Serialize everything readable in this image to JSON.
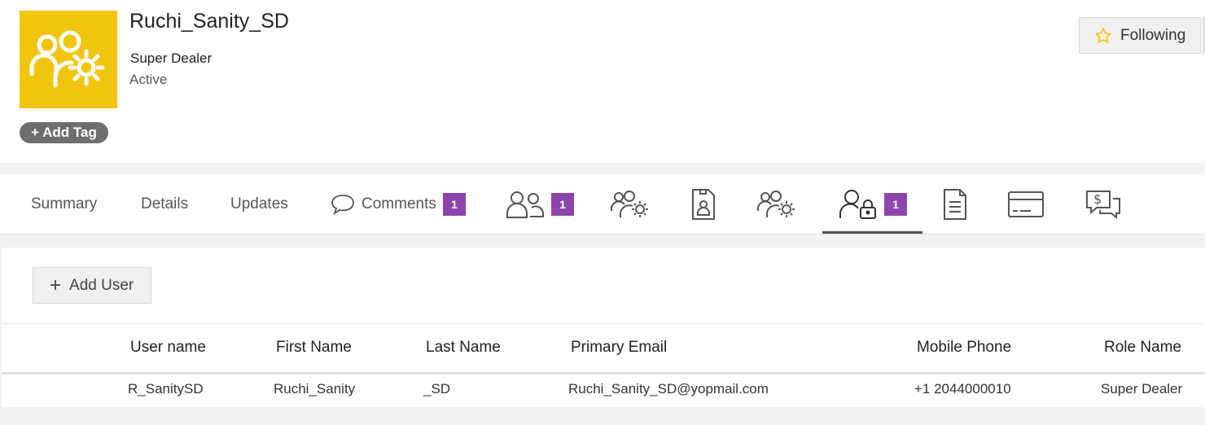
{
  "entity": {
    "name": "Ruchi_Sanity_SD",
    "type": "Super Dealer",
    "status": "Active",
    "logo_color": "#f1c40f",
    "add_tag_label": "Add Tag",
    "follow_label": "Following"
  },
  "tabs": [
    {
      "label": "Summary"
    },
    {
      "label": "Details"
    },
    {
      "label": "Updates"
    },
    {
      "label": "Comments",
      "icon": "speech-bubble-icon",
      "badge": "1"
    },
    {
      "icon": "users-icon",
      "badge": "1"
    },
    {
      "icon": "users-gear-icon"
    },
    {
      "icon": "contact-card-icon"
    },
    {
      "icon": "users-gear-icon"
    },
    {
      "icon": "user-lock-icon",
      "badge": "1",
      "active": true
    },
    {
      "icon": "document-icon"
    },
    {
      "icon": "credit-card-icon"
    },
    {
      "icon": "billing-chat-icon"
    }
  ],
  "users": {
    "add_label": "Add User",
    "columns": [
      "User name",
      "First Name",
      "Last Name",
      "Primary Email",
      "Mobile Phone",
      "Role Name"
    ],
    "rows": [
      [
        "R_SanitySD",
        "Ruchi_Sanity",
        "_SD",
        "Ruchi_Sanity_SD@yopmail.com",
        "+1 2044000010",
        "Super Dealer"
      ]
    ]
  },
  "colors": {
    "badge": "#8e44ad",
    "accent": "#f1c40f"
  }
}
